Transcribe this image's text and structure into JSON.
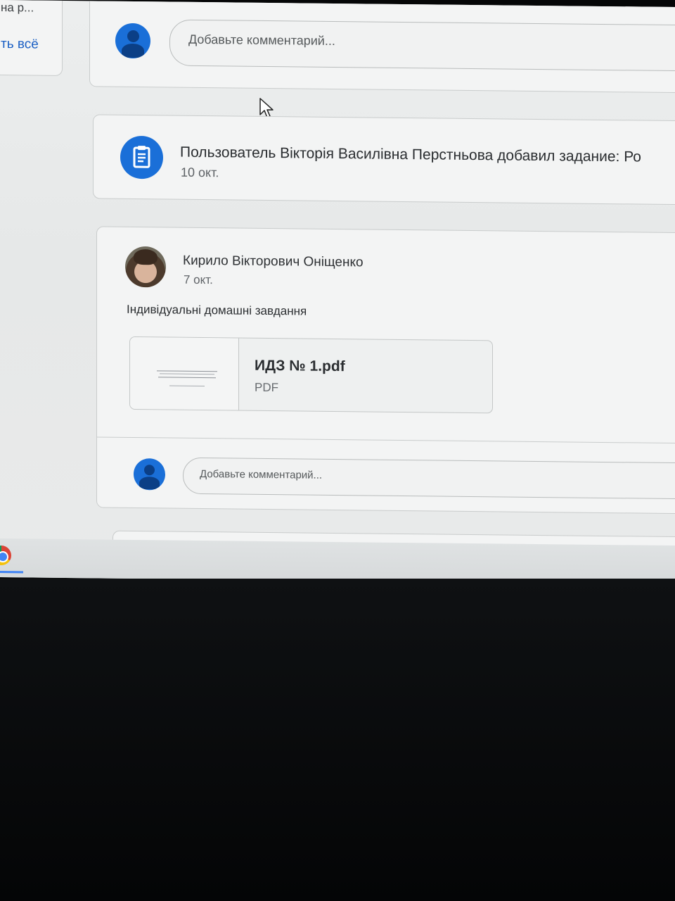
{
  "left_panel": {
    "truncated_label": "на р...",
    "view_all_link": "ть всё"
  },
  "top_comment": {
    "placeholder": "Добавьте комментарий..."
  },
  "assignment_notice": {
    "text": "Пользователь Вікторія Василівна Перстньова добавил задание: Ро",
    "date": "10 окт."
  },
  "post": {
    "author": "Кирило Вікторович Оніщенко",
    "date": "7 окт.",
    "body": "Індивідуальні домашні завдання",
    "attachment": {
      "name": "ИДЗ № 1.pdf",
      "type": "PDF"
    },
    "comment_placeholder": "Добавьте комментарий..."
  },
  "colors": {
    "accent": "#1a6fd8",
    "background": "#eceeee",
    "bezel": "#050607"
  }
}
